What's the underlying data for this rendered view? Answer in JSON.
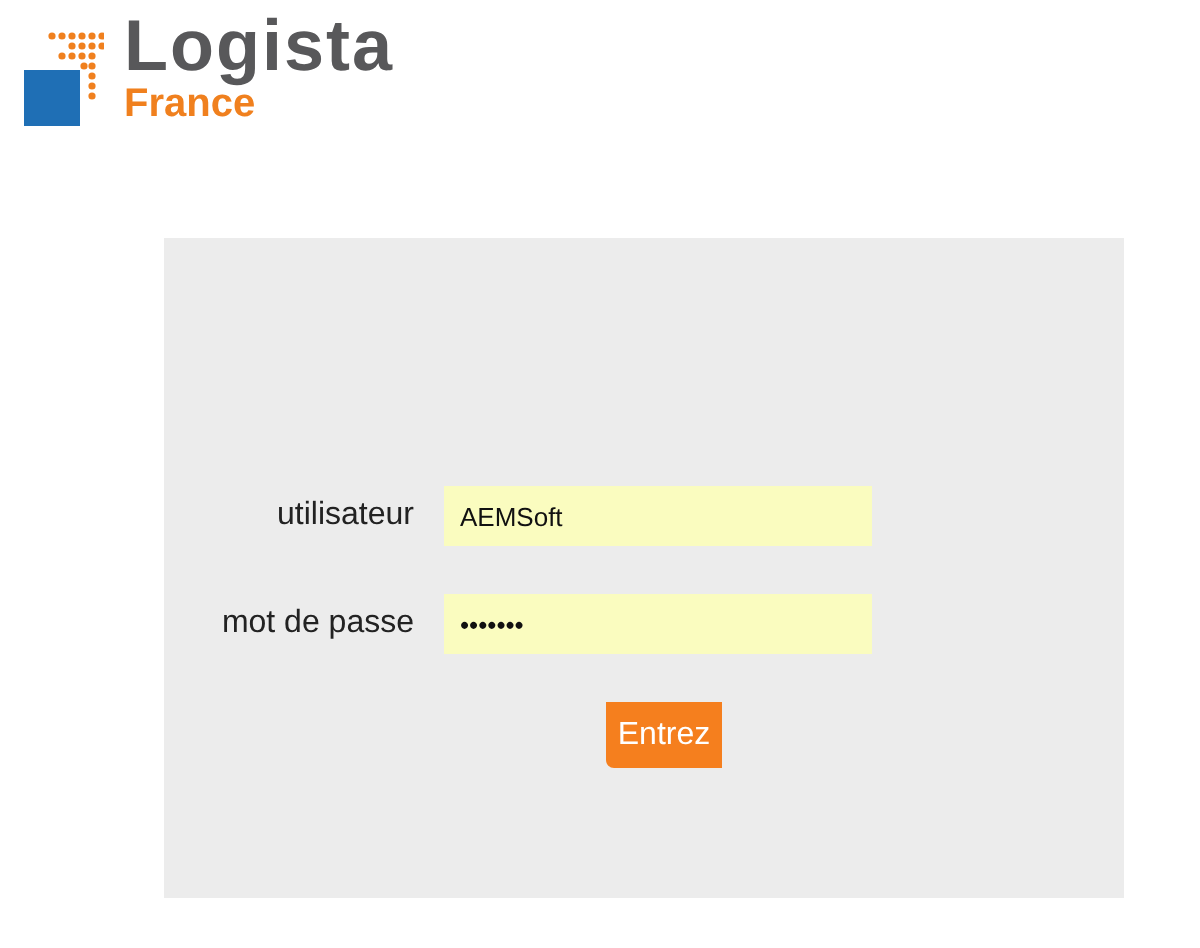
{
  "logo": {
    "name": "Logista",
    "subtitle": "France"
  },
  "form": {
    "fields": [
      {
        "label": "utilisateur",
        "value": "AEMSoft"
      },
      {
        "label": "mot de passe",
        "value": "•••••••"
      }
    ],
    "submit": "Entrez"
  }
}
